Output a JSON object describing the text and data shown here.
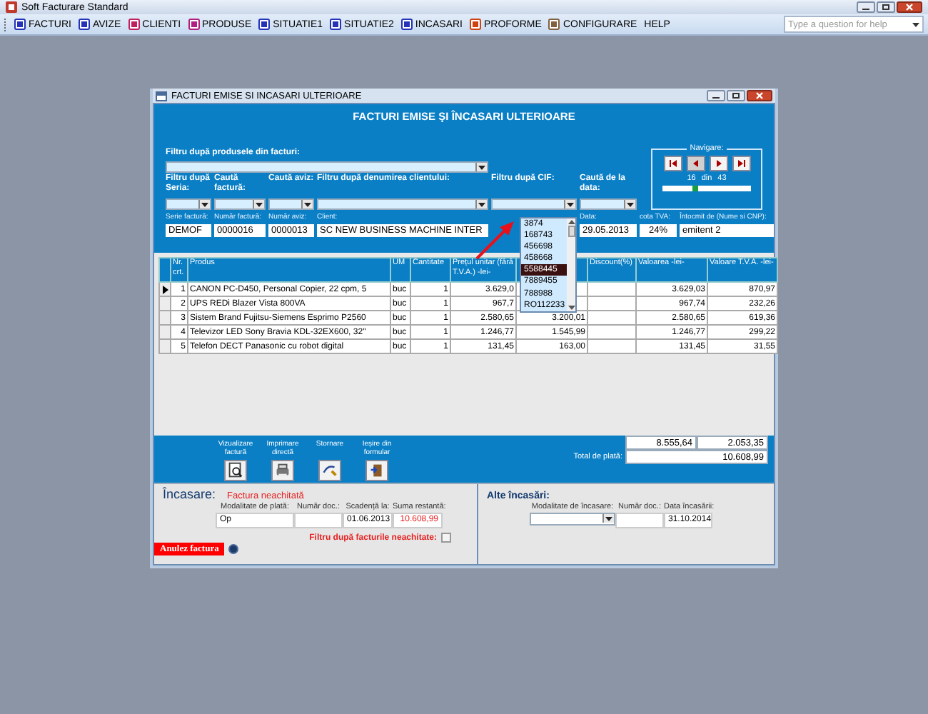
{
  "app": {
    "title": "Soft Facturare Standard"
  },
  "menu": {
    "items": [
      {
        "label": "FACTURI",
        "kind": "icon"
      },
      {
        "label": "AVIZE",
        "kind": "icon"
      },
      {
        "label": "CLIENTI",
        "kind": "icon"
      },
      {
        "label": "PRODUSE",
        "kind": "icon"
      },
      {
        "label": "SITUATIE1",
        "kind": "icon"
      },
      {
        "label": "SITUATIE2",
        "kind": "icon"
      },
      {
        "label": "INCASARI",
        "kind": "icon"
      },
      {
        "label": "PROFORME",
        "kind": "icon"
      },
      {
        "label": "CONFIGURARE",
        "kind": "icon"
      },
      {
        "label": "HELP",
        "kind": "text"
      }
    ],
    "help": {
      "placeholder": "Type a question for help"
    }
  },
  "window": {
    "title": "FACTURI EMISE SI INCASARI ULTERIOARE"
  },
  "heading": "FACTURI EMISE ŞI ÎNCASARI ULTERIOARE",
  "product_filter": {
    "label": "Filtru după produsele din facturi:"
  },
  "filters": [
    {
      "label": "Filtru după Seria:"
    },
    {
      "label": "Caută factură:"
    },
    {
      "label": "Caută aviz:"
    },
    {
      "label": "Filtru după denumirea clientului:"
    },
    {
      "label": "Filtru după CIF:"
    },
    {
      "label": "Caută de la data:"
    }
  ],
  "cif_dropdown": [
    {
      "text": "3874",
      "selected": false
    },
    {
      "text": "168743",
      "selected": false
    },
    {
      "text": "456698",
      "selected": false
    },
    {
      "text": "458668",
      "selected": false
    },
    {
      "text": "5588445",
      "selected": true
    },
    {
      "text": "7889455",
      "selected": false
    },
    {
      "text": "788988",
      "selected": false
    },
    {
      "text": "RO112233",
      "selected": false
    }
  ],
  "navigation": {
    "label": "Navigare:",
    "current": "16",
    "separator": "din",
    "total": "43",
    "level": 0.37
  },
  "invoice_fields": [
    {
      "label": "Serie factură:",
      "value": "DEMOF"
    },
    {
      "label": "Număr factură:",
      "value": "0000016"
    },
    {
      "label": "Număr aviz:",
      "value": "0000013"
    },
    {
      "label": "Client:",
      "value": "SC NEW BUSINESS MACHINE INTER"
    },
    {
      "label": "Data:",
      "value": "29.05.2013"
    },
    {
      "label": "cota TVA:",
      "value": "24%"
    },
    {
      "label": "Întocmit de (Nume si CNP):",
      "value": "emitent 2"
    }
  ],
  "table": {
    "columns": [
      "Nr. crt.",
      "Produs",
      "UM",
      "Cantitate",
      "Prețul unitar (fără T.V.A.) -lei-",
      null,
      "Discount(%)",
      "Valoarea -lei-",
      "Valoare T.V.A. -lei-"
    ],
    "rows": [
      {
        "current": true,
        "cells": [
          "1",
          "CANON PC-D450, Personal Copier, 22 cpm, 5",
          "buc",
          "1",
          "3.629,0",
          null,
          null,
          "3.629,03",
          "870,97"
        ]
      },
      {
        "current": false,
        "cells": [
          "2",
          "UPS REDi Blazer Vista 800VA",
          "buc",
          "1",
          "967,7",
          null,
          null,
          "967,74",
          "232,26"
        ]
      },
      {
        "current": false,
        "cells": [
          "3",
          "Sistem Brand Fujitsu-Siemens Esprimo P2560",
          "buc",
          "1",
          "2.580,65",
          "3.200,01",
          null,
          "2.580,65",
          "619,36"
        ]
      },
      {
        "current": false,
        "cells": [
          "4",
          "Televizor LED Sony Bravia KDL-32EX600, 32\"",
          "buc",
          "1",
          "1.246,77",
          "1.545,99",
          null,
          "1.246,77",
          "299,22"
        ]
      },
      {
        "current": false,
        "cells": [
          "5",
          "Telefon DECT Panasonic cu robot digital",
          "buc",
          "1",
          "131,45",
          "163,00",
          null,
          "131,45",
          "31,55"
        ]
      }
    ]
  },
  "actions": [
    {
      "label": "Vizualizare factură"
    },
    {
      "label": "Imprimare directă"
    },
    {
      "label": "Stornare"
    },
    {
      "label": "Ieșire din formular"
    }
  ],
  "totals": {
    "value": "8.555,64",
    "vat": "2.053,35",
    "total_label": "Total de plată:",
    "total": "10.608,99"
  },
  "payment": {
    "title": "Încasare:",
    "status": "Factura neachitată",
    "fields": [
      {
        "label": "Modalitate de plată:",
        "value": "Op"
      },
      {
        "label": "Număr doc.:"
      },
      {
        "label": "Scadență la:",
        "value": "01.06.2013"
      },
      {
        "label": "Suma restantă:",
        "value": "10.608,99",
        "kind": "alert"
      }
    ],
    "unpaid_filter": {
      "label": "Filtru după facturile neachitate:",
      "checked": false
    },
    "cancel_button": "Anulez factura",
    "cancel_radio": {
      "checked": true
    }
  },
  "other_payments": {
    "title": "Alte încasări:",
    "fields": [
      {
        "label": "Modalitate de încasare:",
        "kind": "combo"
      },
      {
        "label": "Număr doc.:",
        "kind": "text"
      },
      {
        "label": "Data încasării:",
        "kind": "text",
        "value": "31.10.2014"
      }
    ]
  }
}
